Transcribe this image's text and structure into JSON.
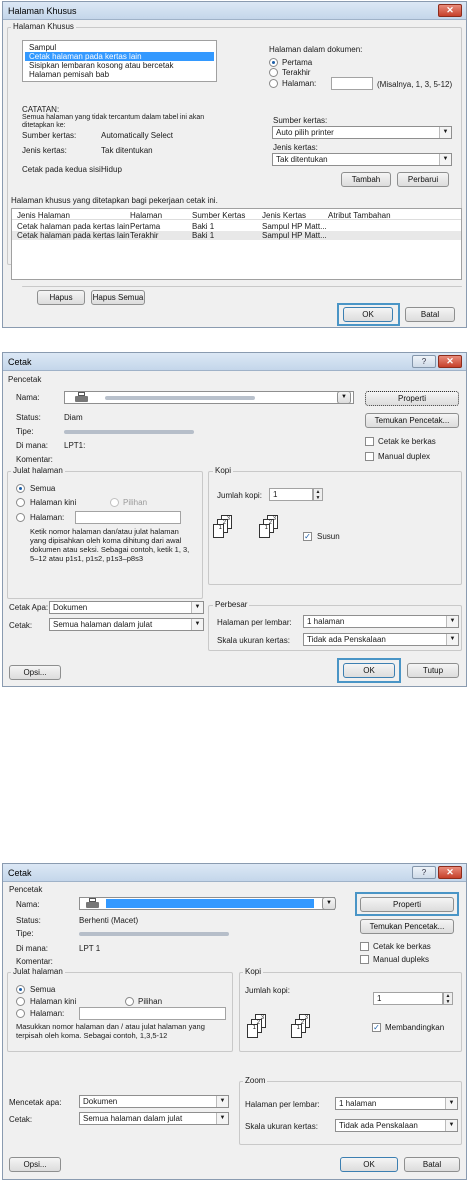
{
  "d1": {
    "title": "Halaman Khusus",
    "group_label": "Halaman Khusus",
    "list_items": [
      "Sampul",
      "Cetak halaman pada kertas lain",
      "Sisipkan lembaran kosong atau bercetak",
      "Halaman pemisah bab"
    ],
    "page_in_doc": "Halaman dalam dokumen:",
    "radio_first": "Pertama",
    "radio_last": "Terakhir",
    "radio_pages": "Halaman:",
    "pages_hint": "(Misalnya, 1, 3, 5-12)",
    "note_title": "CATATAN:",
    "note_text": "Semua halaman yang tidak tercantum dalam tabel ini akan ditetapkan ke:",
    "paper_source_label": "Sumber kertas:",
    "paper_source_val": "Automatically Select",
    "paper_type_label": "Jenis kertas:",
    "paper_type_val": "Tak ditentukan",
    "print_both_label": "Cetak pada kedua sisi:",
    "print_both_val": "Hidup",
    "src_label": "Sumber kertas:",
    "src_select": "Auto pilih printer",
    "type_label": "Jenis kertas:",
    "type_select": "Tak ditentukan",
    "add": "Tambah",
    "update": "Perbarui",
    "table_caption": "Halaman khusus yang ditetapkan bagi pekerjaan cetak ini.",
    "headers": [
      "Jenis Halaman",
      "Halaman",
      "Sumber Kertas",
      "Jenis Kertas",
      "Atribut Tambahan"
    ],
    "rows": [
      [
        "Cetak halaman pada kertas lain",
        "Pertama",
        "Baki 1",
        "Sampul HP Matt...",
        ""
      ],
      [
        "Cetak halaman pada kertas lain",
        "Terakhir",
        "Baki 1",
        "Sampul HP Matt...",
        ""
      ]
    ],
    "delete": "Hapus",
    "delete_all": "Hapus Semua",
    "ok": "OK",
    "cancel": "Batal",
    "close": "✕"
  },
  "d2": {
    "title": "Cetak",
    "printer_group": "Pencetak",
    "name_label": "Nama:",
    "status_label": "Status:",
    "status_val": "Diam",
    "type_label": "Tipe:",
    "where_label": "Di mana:",
    "where_val": "LPT1:",
    "comment_label": "Komentar:",
    "properties": "Properti",
    "find_printer": "Temukan Pencetak...",
    "print_to_file": "Cetak ke berkas",
    "manual_duplex": "Manual duplex",
    "range_group": "Julat halaman",
    "all": "Semua",
    "current": "Halaman kini",
    "selection": "Pilihan",
    "pages": "Halaman:",
    "range_hint": "Ketik nomor halaman dan/atau julat halaman yang dipisahkan oleh koma dihitung dari awal dokumen atau seksi. Sebagai contoh, ketik 1, 3, 5–12 atau p1s1, p1s2, p1s3–p8s3",
    "copies_group": "Kopi",
    "num_copies": "Jumlah kopi:",
    "copies_val": "1",
    "collate": "Susun",
    "print_what_label": "Cetak Apa:",
    "print_what_val": "Dokumen",
    "print_label": "Cetak:",
    "print_val": "Semua halaman dalam julat",
    "zoom_group": "Perbesar",
    "pages_per_sheet": "Halaman per lembar:",
    "pps_val": "1 halaman",
    "scale_label": "Skala ukuran kertas:",
    "scale_val": "Tidak ada Penskalaan",
    "options": "Opsi...",
    "ok": "OK",
    "close": "Tutup",
    "help": "?",
    "x": "✕"
  },
  "d3": {
    "title": "Cetak",
    "printer_group": "Pencetak",
    "name_label": "Nama:",
    "status_label": "Status:",
    "status_val": "Berhenti (Macet)",
    "type_label": "Tipe:",
    "where_label": "Di mana:",
    "where_val": "LPT 1",
    "comment_label": "Komentar:",
    "properties": "Properti",
    "find_printer": "Temukan Pencetak...",
    "print_to_file": "Cetak ke berkas",
    "manual_duplex": "Manual dupleks",
    "range_group": "Julat halaman",
    "all": "Semua",
    "current": "Halaman kini",
    "selection": "Pilihan",
    "pages": "Halaman:",
    "range_hint": "Masukkan nomor halaman dan / atau julat halaman yang terpisah oleh koma. Sebagai contoh, 1,3,5-12",
    "copies_group": "Kopi",
    "num_copies": "Jumlah kopi:",
    "copies_val": "1",
    "collate": "Membandingkan",
    "print_what_label": "Mencetak apa:",
    "print_what_val": "Dokumen",
    "print_label": "Cetak:",
    "print_val": "Semua halaman dalam julat",
    "zoom_group": "Zoom",
    "pages_per_sheet": "Halaman per lembar:",
    "pps_val": "1 halaman",
    "scale_label": "Skala ukuran kertas:",
    "scale_val": "Tidak ada Penskalaan",
    "options": "Opsi...",
    "ok": "OK",
    "close": "Batal",
    "help": "?",
    "x": "✕"
  }
}
